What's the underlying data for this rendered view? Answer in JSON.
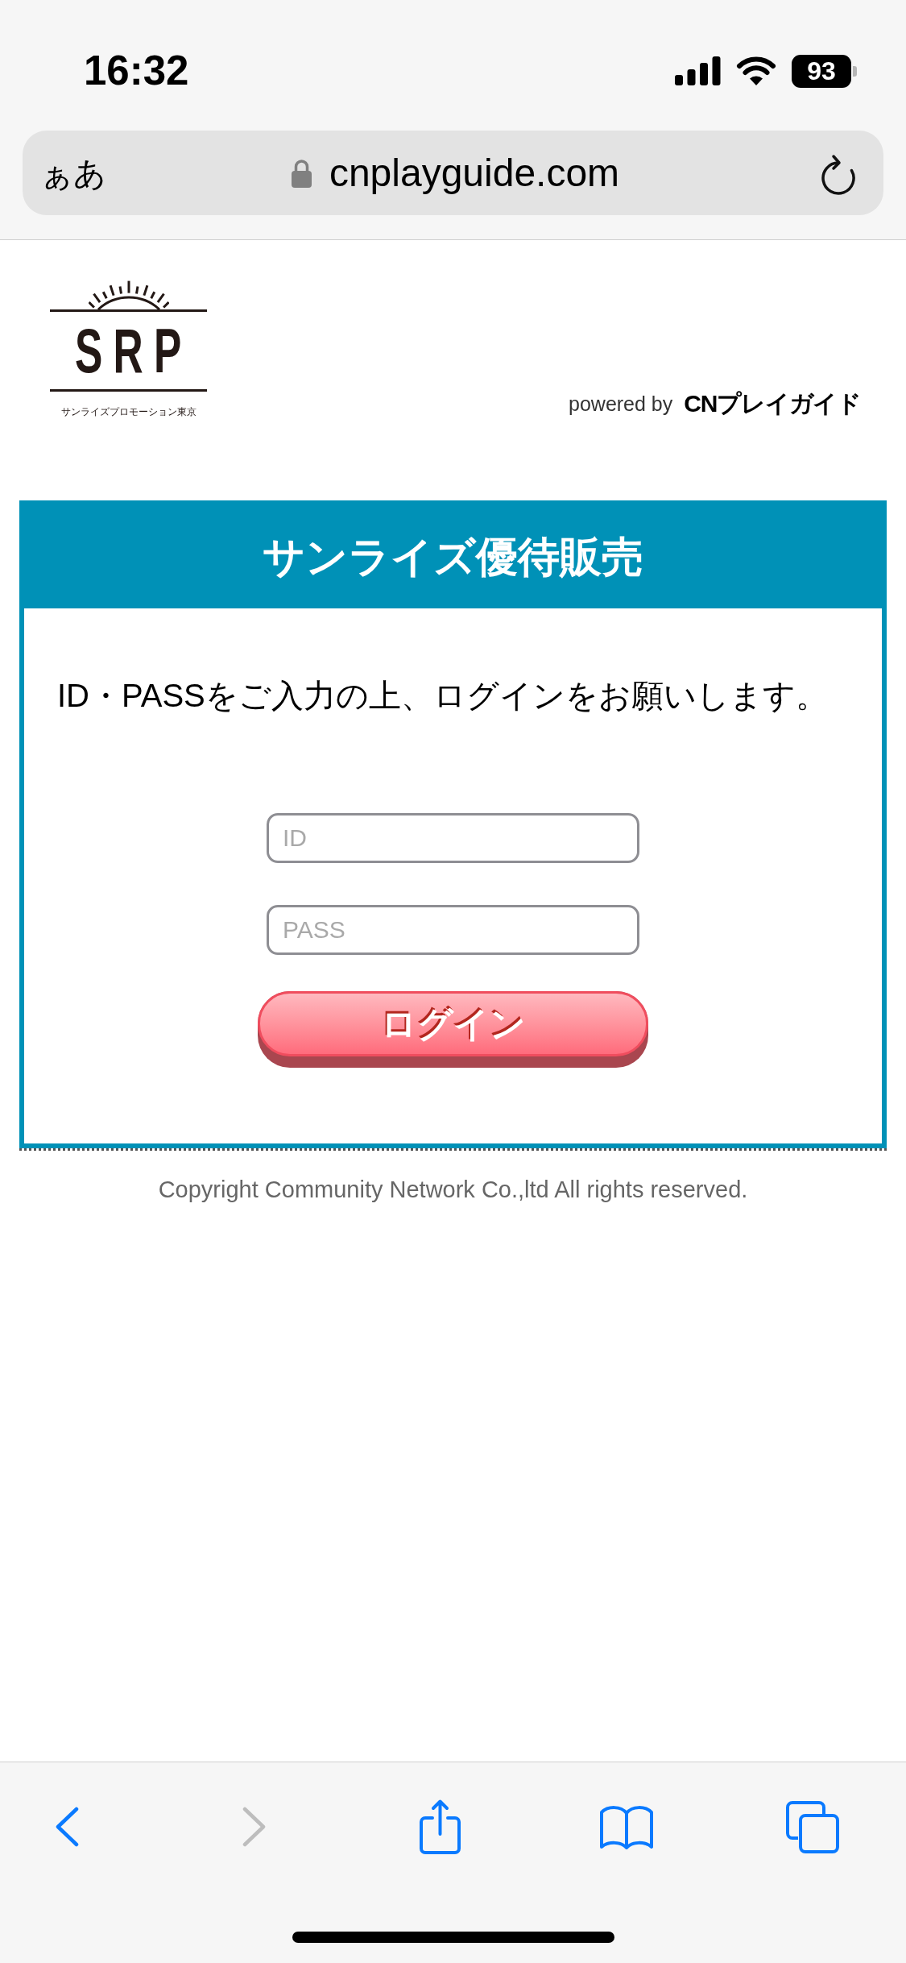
{
  "status_bar": {
    "time": "16:32",
    "battery": "93"
  },
  "address_bar": {
    "text_size_button": "ぁあ",
    "url": "cnplayguide.com"
  },
  "header": {
    "logo": {
      "mark": "SRP",
      "tagline": "サンライズプロモーション東京"
    },
    "powered_by": {
      "label": "powered by",
      "brand": "CNプレイガイド"
    }
  },
  "login_card": {
    "title": "サンライズ優待販売",
    "instruction": "ID・PASSをご入力の上、ログインをお願いします。",
    "fields": [
      {
        "placeholder": "ID"
      },
      {
        "placeholder": "PASS"
      }
    ],
    "submit_button": "ログイン"
  },
  "footer": {
    "copyright": "Copyright Community Network Co.,ltd All rights reserved."
  },
  "toolbar": [
    {
      "kind": "back",
      "disabled": false
    },
    {
      "kind": "forward",
      "disabled": true
    },
    {
      "kind": "share",
      "disabled": false
    },
    {
      "kind": "bookmarks",
      "disabled": false
    },
    {
      "kind": "tabs",
      "disabled": false
    }
  ]
}
